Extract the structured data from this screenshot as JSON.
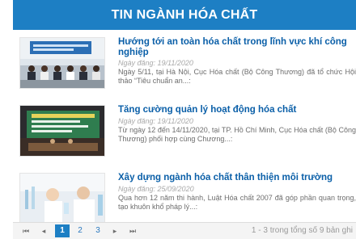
{
  "header": {
    "title": "TIN NGÀNH HÓA CHẤT"
  },
  "items": [
    {
      "title": "Hướng tới an toàn hóa chất trong lĩnh vực khí công nghiệp",
      "date": "Ngày đăng: 19/11/2020",
      "desc": "Ngày 5/11, tại Hà Nội, Cục Hóa chất (Bộ Công Thương) đã tổ chức Hội thảo “Tiêu chuẩn an...:"
    },
    {
      "title": "Tăng cường quản lý hoạt động hóa chất",
      "date": "Ngày đăng: 19/11/2020",
      "desc": "Từ ngày 12 đến 14/11/2020, tại TP. Hồ Chí Minh, Cục Hóa chất (Bộ Công Thương) phối hợp cùng Chương...:"
    },
    {
      "title": "Xây dựng ngành hóa chất thân thiện môi trường",
      "date": "Ngày đăng: 25/09/2020",
      "desc": "Qua hơn 12 năm thi hành, Luật Hóa chất 2007 đã góp phần quan trọng, tạo khuôn khổ pháp lý...:"
    }
  ],
  "pager": {
    "first": "⏮",
    "prev": "◂",
    "pages": [
      "1",
      "2",
      "3"
    ],
    "active_page": "1",
    "next": "▸",
    "last": "⏭",
    "info": "1 - 3 trong tổng số 9 bản ghi"
  },
  "colors": {
    "accent": "#1d7fc4",
    "title": "#0a5fa8"
  }
}
